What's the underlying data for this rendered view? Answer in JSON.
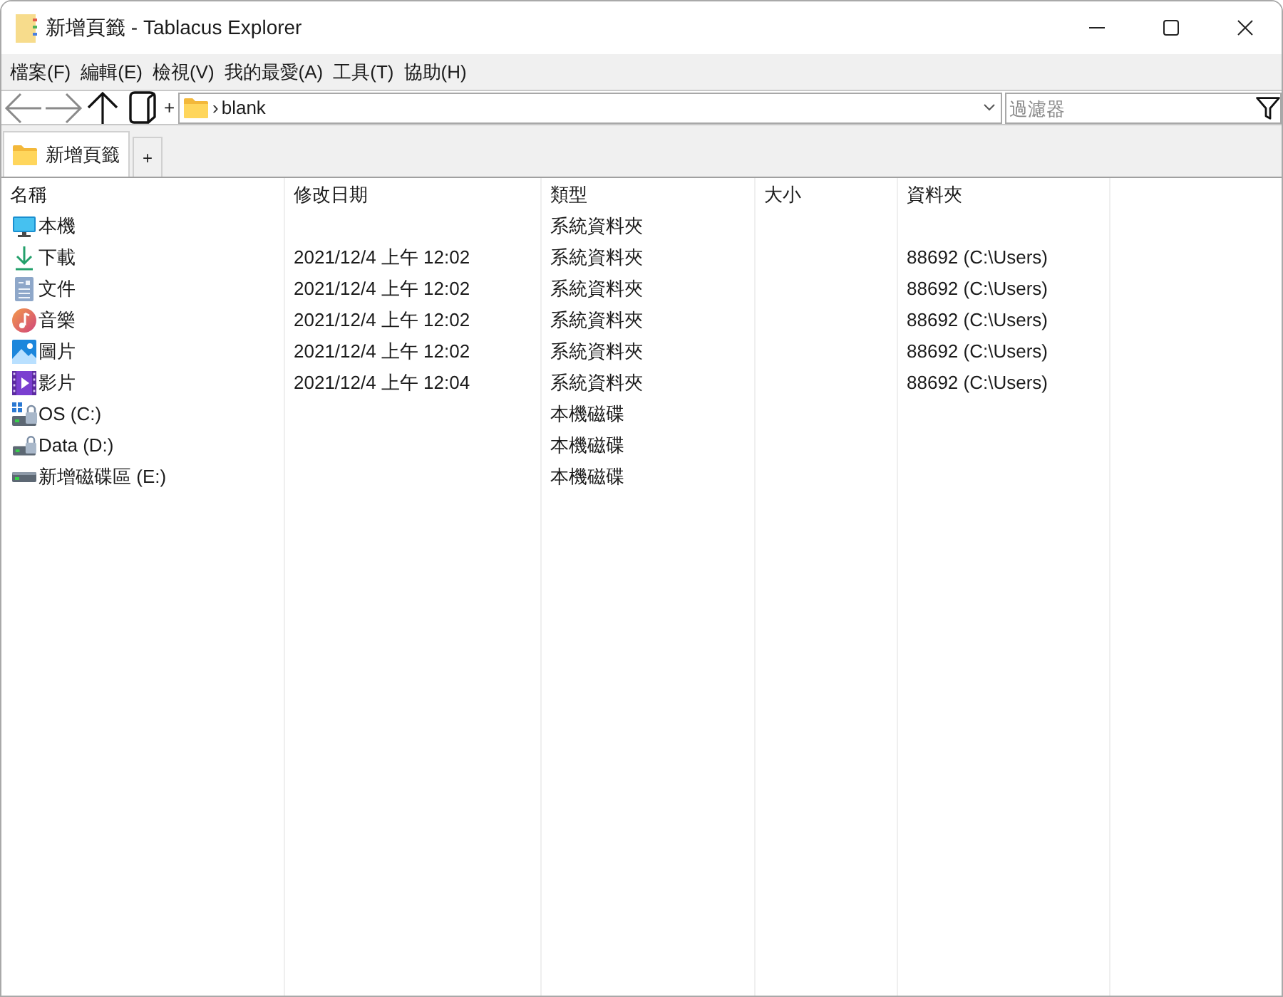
{
  "window": {
    "title": "新增頁籤 - Tablacus Explorer"
  },
  "menu_bar": [
    {
      "label": "檔案(F)"
    },
    {
      "label": "編輯(E)"
    },
    {
      "label": "檢視(V)"
    },
    {
      "label": "我的最愛(A)"
    },
    {
      "label": "工具(T)"
    },
    {
      "label": "協助(H)"
    }
  ],
  "toolbar": {
    "buttons": [
      {
        "kind": "back",
        "disabled": true
      },
      {
        "kind": "forward",
        "disabled": true
      },
      {
        "kind": "up",
        "disabled": false
      },
      {
        "kind": "book",
        "disabled": false
      }
    ],
    "add_label": "+",
    "address": {
      "separator": "›",
      "value": "blank"
    },
    "filter": {
      "placeholder": "過濾器"
    }
  },
  "tabs": [
    {
      "label": "新增頁籤",
      "selected": true
    }
  ],
  "new_tab_button": {
    "label": "+"
  },
  "file_list": {
    "columns": [
      "名稱",
      "修改日期",
      "類型",
      "大小",
      "資料夾"
    ],
    "rows": [
      {
        "kind": "computer",
        "name": "本機",
        "type": "系統資料夾"
      },
      {
        "kind": "downloads",
        "name": "下載",
        "modified": "2021/12/4 上午 12:02",
        "type": "系統資料夾",
        "folder": "88692 (C:\\Users)"
      },
      {
        "kind": "documents",
        "name": "文件",
        "modified": "2021/12/4 上午 12:02",
        "type": "系統資料夾",
        "folder": "88692 (C:\\Users)"
      },
      {
        "kind": "music",
        "name": "音樂",
        "modified": "2021/12/4 上午 12:02",
        "type": "系統資料夾",
        "folder": "88692 (C:\\Users)"
      },
      {
        "kind": "pictures",
        "name": "圖片",
        "modified": "2021/12/4 上午 12:02",
        "type": "系統資料夾",
        "folder": "88692 (C:\\Users)"
      },
      {
        "kind": "videos",
        "name": "影片",
        "modified": "2021/12/4 上午 12:04",
        "type": "系統資料夾",
        "folder": "88692 (C:\\Users)"
      },
      {
        "kind": "system_drive",
        "name": "OS (C:)",
        "type": "本機磁碟"
      },
      {
        "kind": "locked_drive",
        "name": "Data (D:)",
        "type": "本機磁碟"
      },
      {
        "kind": "drive",
        "name": "新增磁碟區 (E:)",
        "type": "本機磁碟"
      }
    ]
  }
}
